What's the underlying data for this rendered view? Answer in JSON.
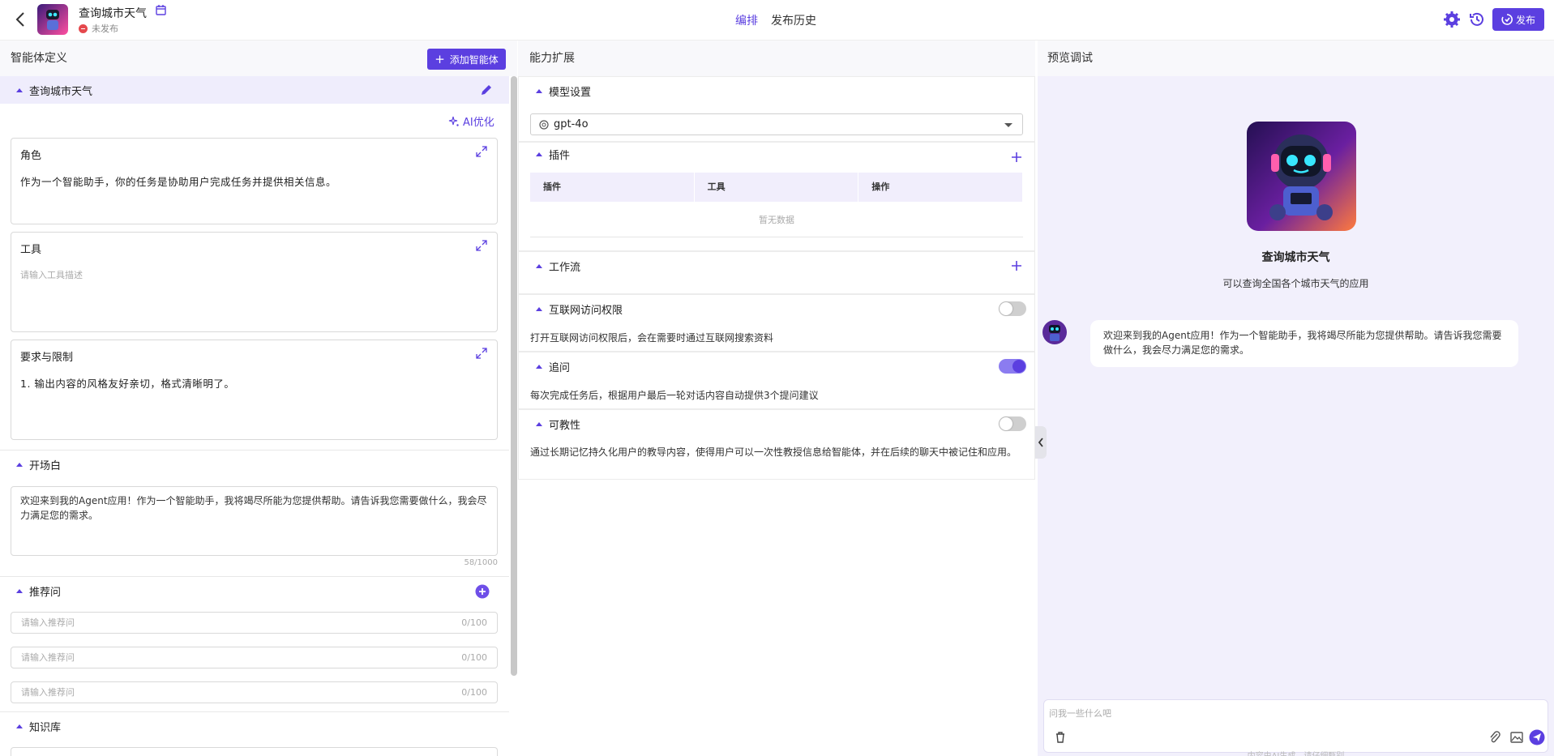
{
  "header": {
    "app_title": "查询城市天气",
    "status": "未发布",
    "tabs": [
      "编排",
      "发布历史"
    ],
    "publish_label": "发布"
  },
  "columns": {
    "left_title": "智能体定义",
    "add_agent_label": "添加智能体",
    "middle_title": "能力扩展",
    "right_title": "预览调试"
  },
  "left": {
    "agent_section": "查询城市天气",
    "ai_optimize": "AI优化",
    "role": {
      "label": "角色",
      "content": "作为一个智能助手，你的任务是协助用户完成任务并提供相关信息。"
    },
    "tools": {
      "label": "工具",
      "placeholder": "请输入工具描述"
    },
    "requirements": {
      "label": "要求与限制",
      "content": "1. 输出内容的风格友好亲切，格式清晰明了。"
    },
    "opening": {
      "label": "开场白",
      "content": "欢迎来到我的Agent应用！作为一个智能助手，我将竭尽所能为您提供帮助。请告诉我您需要做什么，我会尽力满足您的需求。",
      "count": "58/1000"
    },
    "suggestions": {
      "label": "推荐问",
      "items": [
        {
          "placeholder": "请输入推荐问",
          "count": "0/100"
        },
        {
          "placeholder": "请输入推荐问",
          "count": "0/100"
        },
        {
          "placeholder": "请输入推荐问",
          "count": "0/100"
        }
      ]
    },
    "knowledge": {
      "label": "知识库"
    }
  },
  "middle": {
    "model": {
      "label": "模型设置",
      "value": "gpt-4o"
    },
    "plugins": {
      "label": "插件",
      "columns": [
        "插件",
        "工具",
        "操作"
      ],
      "empty": "暂无数据"
    },
    "workflow": {
      "label": "工作流"
    },
    "internet": {
      "label": "互联网访问权限",
      "enabled": false,
      "desc": "打开互联网访问权限后，会在需要时通过互联网搜索资料"
    },
    "followup": {
      "label": "追问",
      "enabled": true,
      "desc": "每次完成任务后，根据用户最后一轮对话内容自动提供3个提问建议"
    },
    "teachable": {
      "label": "可教性",
      "enabled": false,
      "desc": "通过长期记忆持久化用户的教导内容，使得用户可以一次性教授信息给智能体，并在后续的聊天中被记住和应用。"
    }
  },
  "right": {
    "agent_name": "查询城市天气",
    "agent_desc": "可以查询全国各个城市天气的应用",
    "welcome": "欢迎来到我的Agent应用！作为一个智能助手，我将竭尽所能为您提供帮助。请告诉我您需要做什么，我会尽力满足您的需求。",
    "input_placeholder": "问我一些什么吧",
    "footnote": "内容由AI生成，请仔细甄别"
  },
  "colors": {
    "accent": "#5b3fe0",
    "preview_bg": "#f2f0fc",
    "status_red": "#e5484d"
  }
}
